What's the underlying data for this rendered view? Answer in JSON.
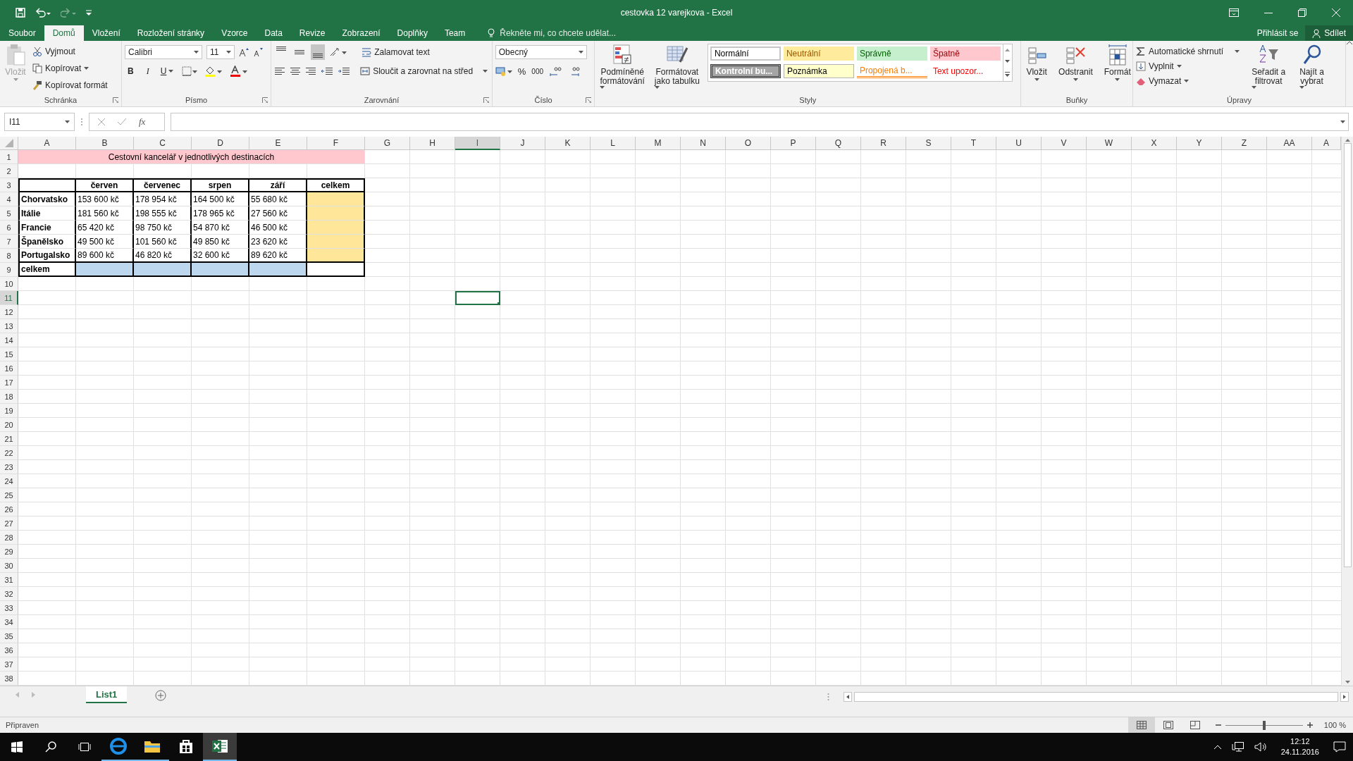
{
  "window": {
    "title": "cestovka 12 varejkova - Excel"
  },
  "tabs": [
    {
      "label": "Soubor",
      "selected": false
    },
    {
      "label": "Domů",
      "selected": true
    },
    {
      "label": "Vložení",
      "selected": false
    },
    {
      "label": "Rozložení stránky",
      "selected": false
    },
    {
      "label": "Vzorce",
      "selected": false
    },
    {
      "label": "Data",
      "selected": false
    },
    {
      "label": "Revize",
      "selected": false
    },
    {
      "label": "Zobrazení",
      "selected": false
    },
    {
      "label": "Doplňky",
      "selected": false
    },
    {
      "label": "Team",
      "selected": false
    }
  ],
  "tell_me": {
    "placeholder": "Řekněte mi, co chcete udělat..."
  },
  "account": {
    "sign_in": "Přihlásit se",
    "share": "Sdílet"
  },
  "ribbon": {
    "groups": [
      {
        "kind": "clipboard",
        "label": "Schránka",
        "paste": {
          "label": "Vložit",
          "disabled": true
        },
        "buttons": [
          "Vyjmout",
          "Kopírovat",
          "Kopírovat formát"
        ]
      },
      {
        "kind": "font",
        "label": "Písmo",
        "font": "Calibri",
        "size": "11",
        "bold": "B",
        "italic": "I",
        "underline": "U"
      },
      {
        "kind": "alignment",
        "label": "Zarovnání",
        "valign_buttons": [
          {
            "selected": false
          },
          {
            "selected": false
          },
          {
            "selected": true
          }
        ],
        "wrap": "Zalamovat text",
        "merge": "Sloučit a zarovnat na střed"
      },
      {
        "kind": "number",
        "label": "Číslo",
        "format": "Obecný",
        "percent": "%",
        "thousands": "000"
      },
      {
        "kind": "styles",
        "label": "Styly",
        "conditional": [
          "Podmíněné",
          "formátování"
        ],
        "as_table": [
          "Formátovat",
          "jako tabulku"
        ],
        "styles": [
          {
            "label": "Normální",
            "kind": "normal"
          },
          {
            "label": "Neutrální",
            "kind": "neutral"
          },
          {
            "label": "Správně",
            "kind": "good"
          },
          {
            "label": "Špatně",
            "kind": "bad"
          },
          {
            "label": "Kontrolní bu...",
            "kind": "check"
          },
          {
            "label": "Poznámka",
            "kind": "note"
          },
          {
            "label": "Propojená b...",
            "kind": "linked"
          },
          {
            "label": "Text upozor...",
            "kind": "warning"
          }
        ]
      },
      {
        "kind": "cells",
        "label": "Buňky",
        "buttons": [
          "Vložit",
          "Odstranit",
          "Formát"
        ]
      },
      {
        "kind": "editing",
        "label": "Úpravy",
        "autosum": "Automatické shrnutí",
        "fill": "Vyplnit",
        "clear": "Vymazat",
        "sort": [
          "Seřadit a",
          "filtrovat"
        ],
        "find": [
          "Najít a",
          "vybrat"
        ]
      }
    ]
  },
  "formula_bar": {
    "name_box": "I11",
    "function_label": "fx"
  },
  "sheet": {
    "columns": [
      {
        "label": "A",
        "selected": false
      },
      {
        "label": "B",
        "selected": false
      },
      {
        "label": "C",
        "selected": false
      },
      {
        "label": "D",
        "selected": false
      },
      {
        "label": "E",
        "selected": false
      },
      {
        "label": "F",
        "selected": false
      },
      {
        "label": "G",
        "selected": false
      },
      {
        "label": "H",
        "selected": false
      },
      {
        "label": "I",
        "selected": true
      },
      {
        "label": "J",
        "selected": false
      },
      {
        "label": "K",
        "selected": false
      },
      {
        "label": "L",
        "selected": false
      },
      {
        "label": "M",
        "selected": false
      },
      {
        "label": "N",
        "selected": false
      },
      {
        "label": "O",
        "selected": false
      },
      {
        "label": "P",
        "selected": false
      },
      {
        "label": "Q",
        "selected": false
      },
      {
        "label": "R",
        "selected": false
      },
      {
        "label": "S",
        "selected": false
      },
      {
        "label": "T",
        "selected": false
      },
      {
        "label": "U",
        "selected": false
      },
      {
        "label": "V",
        "selected": false
      },
      {
        "label": "W",
        "selected": false
      },
      {
        "label": "X",
        "selected": false
      },
      {
        "label": "Y",
        "selected": false
      },
      {
        "label": "Z",
        "selected": false
      },
      {
        "label": "AA",
        "selected": false
      },
      {
        "label": "A",
        "selected": false
      }
    ],
    "rows": [
      {
        "label": "1",
        "selected": false
      },
      {
        "label": "2",
        "selected": false
      },
      {
        "label": "3",
        "selected": false
      },
      {
        "label": "4",
        "selected": false
      },
      {
        "label": "5",
        "selected": false
      },
      {
        "label": "6",
        "selected": false
      },
      {
        "label": "7",
        "selected": false
      },
      {
        "label": "8",
        "selected": false
      },
      {
        "label": "9",
        "selected": false
      },
      {
        "label": "10",
        "selected": false
      },
      {
        "label": "11",
        "selected": true
      },
      {
        "label": "12",
        "selected": false
      },
      {
        "label": "13",
        "selected": false
      },
      {
        "label": "14",
        "selected": false
      },
      {
        "label": "15",
        "selected": false
      },
      {
        "label": "16",
        "selected": false
      },
      {
        "label": "17",
        "selected": false
      },
      {
        "label": "18",
        "selected": false
      },
      {
        "label": "19",
        "selected": false
      },
      {
        "label": "20",
        "selected": false
      },
      {
        "label": "21",
        "selected": false
      },
      {
        "label": "22",
        "selected": false
      },
      {
        "label": "23",
        "selected": false
      },
      {
        "label": "24",
        "selected": false
      },
      {
        "label": "25",
        "selected": false
      },
      {
        "label": "26",
        "selected": false
      },
      {
        "label": "27",
        "selected": false
      },
      {
        "label": "28",
        "selected": false
      },
      {
        "label": "29",
        "selected": false
      },
      {
        "label": "30",
        "selected": false
      },
      {
        "label": "31",
        "selected": false
      },
      {
        "label": "32",
        "selected": false
      },
      {
        "label": "33",
        "selected": false
      },
      {
        "label": "34",
        "selected": false
      },
      {
        "label": "35",
        "selected": false
      },
      {
        "label": "36",
        "selected": false
      },
      {
        "label": "37",
        "selected": false
      },
      {
        "label": "38",
        "selected": false
      }
    ],
    "title": "Cestovní kancelář v jednotlivých destinacích",
    "header": [
      "červen",
      "červenec",
      "srpen",
      "září",
      "celkem"
    ],
    "table_rows": [
      {
        "label": "Chorvatsko",
        "values": [
          "153 600 kč",
          "178 954 kč",
          "164 500 kč",
          "55 680 kč"
        ]
      },
      {
        "label": "Itálie",
        "values": [
          "181 560 kč",
          "198 555 kč",
          "178 965 kč",
          "27 560 kč"
        ]
      },
      {
        "label": "Francie",
        "values": [
          "65 420 kč",
          "98 750 kč",
          "54 870 kč",
          "46 500 kč"
        ]
      },
      {
        "label": "Španělsko",
        "values": [
          "49 500 kč",
          "101 560 kč",
          "49 850 kč",
          "23 620 kč"
        ]
      },
      {
        "label": "Portugalsko",
        "values": [
          "89 600 kč",
          "46 820 kč",
          "32 600 kč",
          "89 620 kč"
        ]
      }
    ],
    "total_label": "celkem"
  },
  "sheet_tabs": [
    {
      "label": "List1",
      "selected": true
    }
  ],
  "status_bar": {
    "text": "Připraven",
    "views": [
      {
        "selected": true
      },
      {
        "selected": false
      },
      {
        "selected": false
      }
    ],
    "zoom": {
      "level": 0.5,
      "reading": "100 %"
    }
  },
  "taskbar": {
    "apps": [
      {
        "kind": "browser",
        "running": true,
        "selected": false
      },
      {
        "kind": "files",
        "running": true,
        "selected": false
      },
      {
        "kind": "store",
        "running": false,
        "selected": false
      },
      {
        "kind": "spreadsheet",
        "running": true,
        "selected": true
      }
    ],
    "time": "12:12",
    "date": "24.11.2016"
  }
}
